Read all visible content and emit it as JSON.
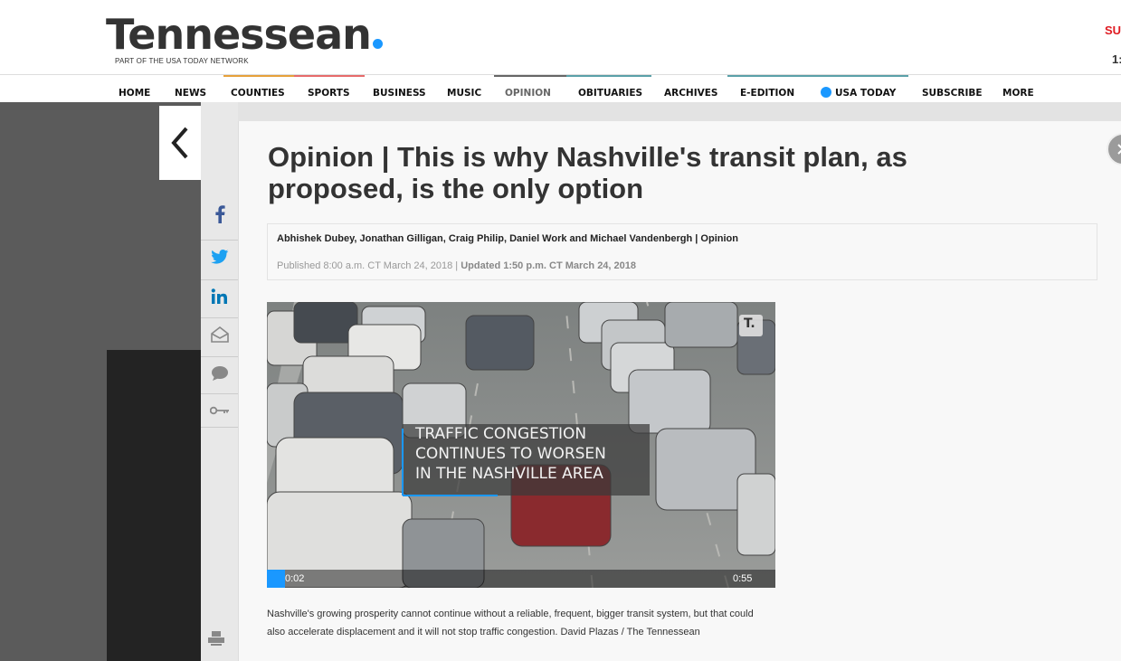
{
  "header": {
    "logo": "Tennessean",
    "logo_sub": "PART OF THE USA TODAY NETWORK",
    "corner_text": "SU",
    "corner_text2": "1:"
  },
  "nav": [
    {
      "label": "HOME"
    },
    {
      "label": "NEWS"
    },
    {
      "label": "COUNTIES"
    },
    {
      "label": "SPORTS"
    },
    {
      "label": "BUSINESS"
    },
    {
      "label": "MUSIC"
    },
    {
      "label": "OPINION"
    },
    {
      "label": "OBITUARIES"
    },
    {
      "label": "ARCHIVES"
    },
    {
      "label": "E-EDITION"
    },
    {
      "label": "USA TODAY"
    },
    {
      "label": "SUBSCRIBE"
    },
    {
      "label": "MORE"
    }
  ],
  "share": [
    "facebook-icon",
    "twitter-icon",
    "linkedin-icon",
    "email-icon",
    "comment-icon",
    "key-icon"
  ],
  "article": {
    "title": "Opinion | This is why Nashville's transit plan, as proposed, is the only option",
    "authors": "Abhishek Dubey, Jonathan Gilligan, Craig Philip, Daniel Work and Michael Vandenbergh | Opinion",
    "published": "Published 8:00 a.m. CT March 24, 2018 | ",
    "updated": "Updated 1:50 p.m. CT March 24, 2018",
    "caption": "Nashville's growing prosperity cannot continue without a reliable, frequent, bigger transit system, but that could also accelerate displacement and it will not stop traffic congestion. David Plazas / The Tennessean"
  },
  "video": {
    "overlay_text": [
      "TRAFFIC CONGESTION",
      "CONTINUES TO WORSEN",
      "IN THE NASHVILLE AREA"
    ],
    "badge": "T.",
    "current_time": "0:02",
    "duration": "0:55",
    "progress": 0.036
  },
  "colors": {
    "accent": "#1a98ff",
    "subscribe_red": "#e01b22"
  }
}
